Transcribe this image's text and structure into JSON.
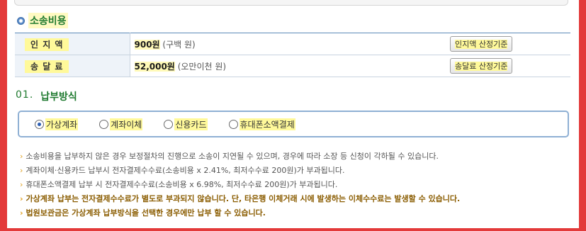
{
  "section_title": "소송비용",
  "fees": [
    {
      "label": "인 지 액",
      "amount": "900원",
      "amount_korean": "(구백 원)",
      "button": "인지액 산정기준"
    },
    {
      "label": "송 달 료",
      "amount": "52,000원",
      "amount_korean": "(오만이천 원)",
      "button": "송달료 산정기준"
    }
  ],
  "payment": {
    "number": "01.",
    "title": "납부방식",
    "options": [
      {
        "label": "가상계좌",
        "selected": true
      },
      {
        "label": "계좌이체",
        "selected": false
      },
      {
        "label": "신용카드",
        "selected": false
      },
      {
        "label": "휴대폰소액결제",
        "selected": false
      }
    ]
  },
  "notes": [
    "소송비용을 납부하지 않은 경우 보정절차의 진행으로 소송이 지연될 수 있으며, 경우에 따라 소장 등 신청이 각하될 수 있습니다.",
    "계좌이체·신용카드 납부시 전자결제수수료(소송비용 x 2.41%, 최저수수료 200원)가 부과됩니다.",
    "휴대폰소액결제 납부 시 전자결제수수료(소송비용 x 6.98%, 최저수수료 200원)가 부과됩니다.",
    "가상계좌 납부는 전자결제수수료가 별도로 부과되지 않습니다. 단, 타은행 이체거래 시에 발생하는 이체수수료는 발생할 수 있습니다.",
    "법원보관금은 가상계좌 납부방식을 선택한 경우에만 납부 할 수 있습니다."
  ],
  "colors": {
    "frame": "#e33a3a",
    "title_green": "#1f7a2f",
    "highlight": "#fff99a",
    "table_border": "#5b89b8"
  }
}
